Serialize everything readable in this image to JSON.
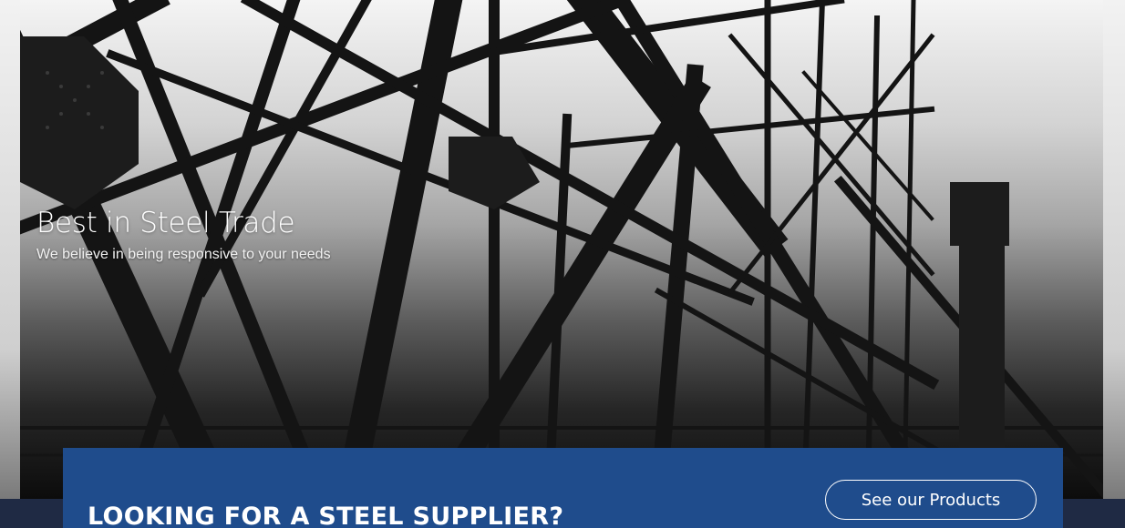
{
  "hero": {
    "title": "Best in Steel Trade",
    "subtitle": "We believe in being responsive to your needs",
    "image_icon": "steel-bridge-image"
  },
  "cta": {
    "heading": "LOOKING FOR A STEEL SUPPLIER?",
    "button_label": "See our Products",
    "panel_color": "#1f4c8c",
    "band_color": "#1f2a44"
  }
}
